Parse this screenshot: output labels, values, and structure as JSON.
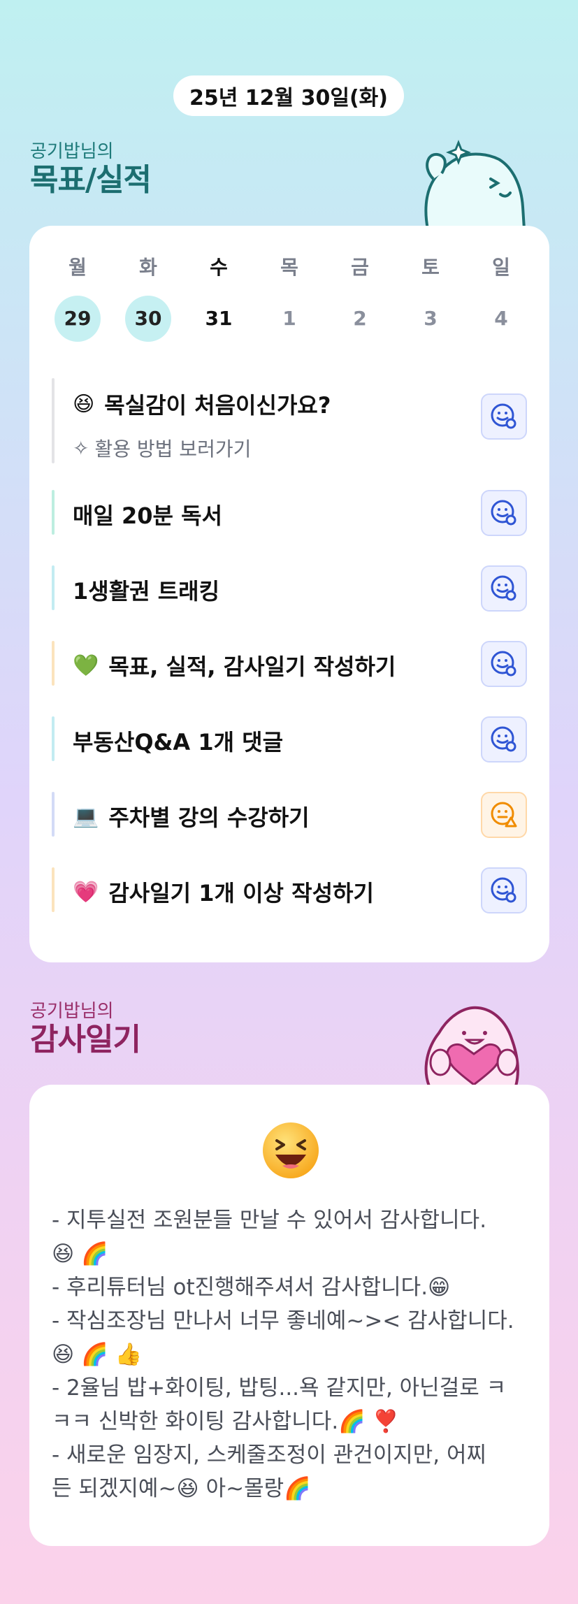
{
  "date": "25년 12월 30일(화)",
  "goals_section": {
    "owner": "공기밥님의",
    "title": "목표/실적"
  },
  "week": [
    {
      "dow": "월",
      "num": "29",
      "state": "done"
    },
    {
      "dow": "화",
      "num": "30",
      "state": "done"
    },
    {
      "dow": "수",
      "num": "31",
      "state": "today"
    },
    {
      "dow": "목",
      "num": "1",
      "state": "future"
    },
    {
      "dow": "금",
      "num": "2",
      "state": "future"
    },
    {
      "dow": "토",
      "num": "3",
      "state": "future"
    },
    {
      "dow": "일",
      "num": "4",
      "state": "future"
    }
  ],
  "goals": [
    {
      "emoji": "😆",
      "title": "목실감이 처음이신가요?",
      "guide": "활용 방법 보러가기",
      "bar_color": "#e3e3e6",
      "status": "blue"
    },
    {
      "emoji": "",
      "title": "매일 20분 독서",
      "bar_color": "#bdeee0",
      "status": "blue"
    },
    {
      "emoji": "",
      "title": "1생활권 트래킹",
      "bar_color": "#c3ecf2",
      "status": "blue"
    },
    {
      "emoji": "💚",
      "title": "목표, 실적, 감사일기 작성하기",
      "bar_color": "#fbe3bd",
      "status": "blue"
    },
    {
      "emoji": "",
      "title": "부동산Q&A 1개 댓글",
      "bar_color": "#c3ecf2",
      "status": "blue"
    },
    {
      "emoji": "💻",
      "title": "주차별 강의 수강하기",
      "bar_color": "#d3dbf6",
      "status": "orange"
    },
    {
      "emoji": "💗",
      "title": "감사일기 1개 이상 작성하기",
      "bar_color": "#fbe3bd",
      "status": "blue"
    }
  ],
  "diary_section": {
    "owner": "공기밥님의",
    "title": "감사일기"
  },
  "diary": {
    "lines": [
      "- 지투실전 조원분들 만날 수 있어서 감사합니다.",
      "😆 🌈",
      "- 후리튜터님 ot진행해주셔서 감사합니다.😁",
      "- 작심조장님 만나서 너무 좋네예~>< 감사합니다.",
      "😆 🌈 👍",
      "- 2율님 밥+화이팅, 밥팅...욕 같지만, 아닌걸로 ㅋ",
      "ㅋㅋ 신박한 화이팅 감사합니다.🌈 ❣️",
      "- 새로운 임장지, 스케줄조정이 관건이지만, 어찌",
      "든 되겠지예~😆 아~몰랑🌈"
    ]
  },
  "colors": {
    "accent_teal": "#1c6e70",
    "accent_pink": "#8e2460",
    "status_blue": "#2f55d4",
    "status_orange": "#f08c00"
  }
}
